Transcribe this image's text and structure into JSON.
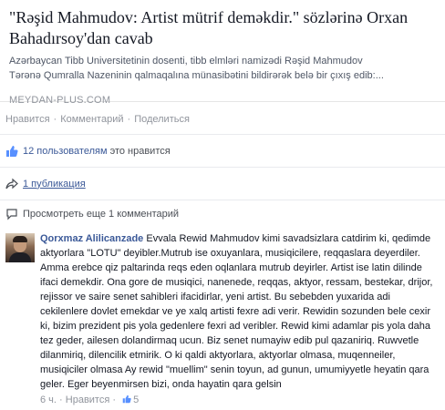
{
  "link_preview": {
    "title": "\"Rəşid Mahmudov: Artist mütrif deməkdir.\" sözlərinə Orxan Bahadırsoy'dan cavab",
    "description_line1": "Azərbaycan Tibb Universitetinin dosenti, tibb elmləri namizədi Rəşid Mahmudov",
    "description_line2": "Tərənə Qumralla Nazeninin qalmaqalına münasibətini bildirərək belə bir çıxış edib:...",
    "source": "MEYDAN-PLUS.COM"
  },
  "actions": {
    "like": "Нравится",
    "comment": "Комментарий",
    "share": "Поделиться",
    "separator": "·"
  },
  "likes_summary": {
    "count_text": "12 пользователям",
    "suffix": " это нравится",
    "icon": "thumbs-up-icon"
  },
  "shares_summary": {
    "text": "1 публикация",
    "icon": "share-arrow-icon"
  },
  "more_comments": {
    "text": "Просмотреть еще 1 комментарий",
    "icon": "comment-bubble-icon"
  },
  "comment": {
    "author": "Qorxmaz Alilicanzade",
    "text": "Evvala Rewid Mahmudov kimi savadsizlara catdirim ki, qedimde aktyorlara \"LOTU\" deyibler.Mutrub ise oxuyanlara, musiqicilere, reqqaslara deyerdiler. Amma erebce qiz paltarinda reqs eden oqlanlara mutrub deyirler. Artist ise latin dilinde ifaci demekdir. Ona gore de musiqici, nanenede, reqqas, aktyor, ressam, bestekar, drijor, rejissor ve saire senet sahibleri ifacidirlar, yeni artist. Bu sebebden yuxarida adi cekilenlere dovlet emekdar ve ye xalq artisti fexre adi verir. Rewidin sozunden bele cexir ki, bizim prezident pis yola gedenlere fexri ad veribler. Rewid kimi adamlar pis yola daha tez geder, ailesen dolandirmaq ucun. Biz senet numayiw edib pul qazaniriq. Ruwvetle dilanmiriq, dilencilik etmirik. O ki qaldi aktyorlara, aktyorlar olmasa, muqenneiler, musiqiciler olmasa Ay rewid \"muellim\" senin toyun, ad gunun, umumiyyetle heyatin qara geler. Eger beyenmirsen bizi, onda hayatin qara gelsin",
    "time": "6 ч.",
    "like": "Нравится",
    "like_count": "5"
  }
}
